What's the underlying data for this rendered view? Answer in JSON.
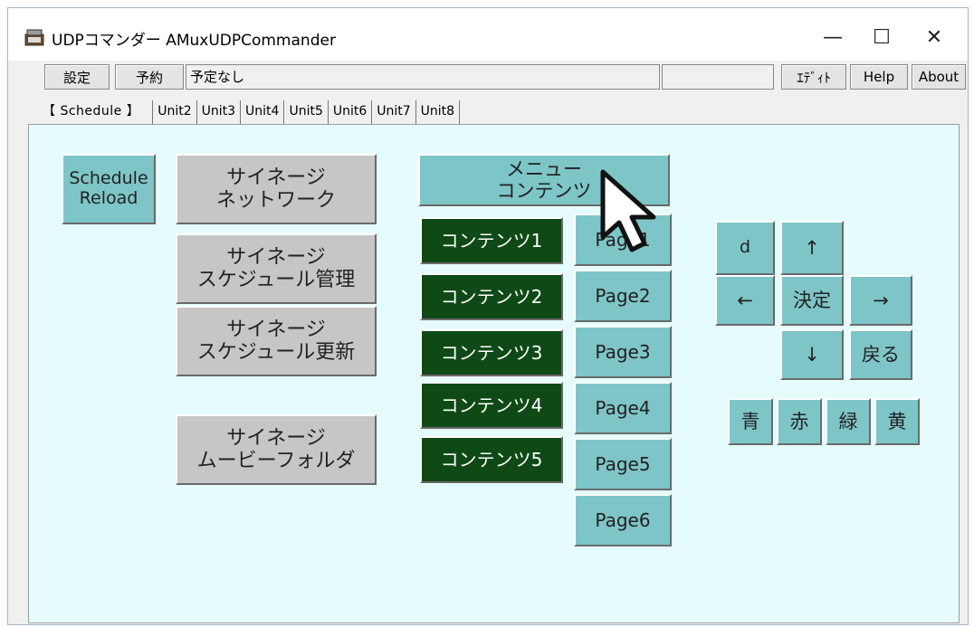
{
  "window": {
    "title": "UDPコマンダー AMuxUDPCommander"
  },
  "window_controls": {
    "minimize": "—",
    "maximize": "☐",
    "close": "✕"
  },
  "toolbar": {
    "settings_label": "設定",
    "reserve_label": "予約",
    "reserve_status": "予定なし",
    "blank_field": "",
    "edit_label": "ｴﾃﾞｨﾄ",
    "help_label": "Help",
    "about_label": "About"
  },
  "tabs": [
    "【 Schedule 】",
    "Unit2",
    "Unit3",
    "Unit4",
    "Unit5",
    "Unit6",
    "Unit7",
    "Unit8"
  ],
  "buttons": {
    "schedule_reload": "Schedule\nReload",
    "signage_network": "サイネージ\nネットワーク",
    "signage_schedule_manage": "サイネージ\nスケジュール管理",
    "signage_schedule_update": "サイネージ\nスケジュール更新",
    "signage_movie_folder": "サイネージ\nムービーフォルダ",
    "menu_contents": "メニュー\nコンテンツ",
    "contents": [
      "コンテンツ1",
      "コンテンツ2",
      "コンテンツ3",
      "コンテンツ4",
      "コンテンツ5"
    ],
    "pages": [
      "Page1",
      "Page2",
      "Page3",
      "Page4",
      "Page5",
      "Page6"
    ],
    "remote": {
      "d": "d",
      "up": "↑",
      "left": "←",
      "enter": "決定",
      "right": "→",
      "down": "↓",
      "back": "戻る"
    },
    "colors": [
      "青",
      "赤",
      "緑",
      "黄"
    ]
  },
  "colors": {
    "teal": "#7ec5c7",
    "gray": "#c6c6c6",
    "green": "#0f4a16",
    "panel": "#e6fcfc"
  }
}
